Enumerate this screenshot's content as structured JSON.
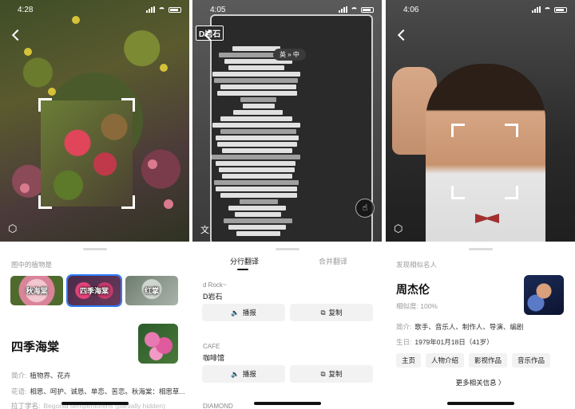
{
  "statusbar": {
    "time1": "4:28",
    "time2": "4:05",
    "time3": "4:06"
  },
  "plant": {
    "section_label": "图中的植物是",
    "chips": [
      {
        "label": "秋海棠"
      },
      {
        "label": "四季海棠"
      },
      {
        "label": "红掌"
      }
    ],
    "name": "四季海棠",
    "intro_key": "简介:",
    "intro_val": "植物界、花卉",
    "lang_key": "花语:",
    "lang_val": "相思、呵护、诚恳、单恋、苦恋。秋海棠：相思草...",
    "latin_key": "拉丁学名:",
    "latin_val": "Begonia semperflorens (partially hidden)"
  },
  "doc": {
    "tag": "D岩石",
    "lang_pill": "英 » 中",
    "tabs": [
      "分行翻译",
      "合并翻译"
    ],
    "items": [
      {
        "src": "d Rock~",
        "dst": "D岩石",
        "play": "播报",
        "copy": "复制"
      },
      {
        "src": "CAFE",
        "dst": "咖啡馆",
        "play": "播报",
        "copy": "复制"
      },
      {
        "src": "DIAMOND",
        "dst": ""
      }
    ],
    "overlay_lines": [
      "金刚石",
      "D岩石咖啡",
      "述你的菜单",
      "吉他手",
      "蓝花玉米片",
      "西南香香",
      "泰国菜",
      "选择毛",
      "烟熏劲骨",
      "烤猪"
    ]
  },
  "face": {
    "section_label": "发现相似名人",
    "name": "周杰伦",
    "similarity_key": "相似度:",
    "similarity_val": "100%",
    "intro_key": "简介:",
    "intro_val": "歌手、音乐人、制作人、导演、编剧",
    "birth_key": "生日:",
    "birth_val": "1979年01月18日（41岁）",
    "tags": [
      "主页",
      "人物介绍",
      "影视作品",
      "音乐作品"
    ],
    "more": "更多相关信息 〉"
  }
}
